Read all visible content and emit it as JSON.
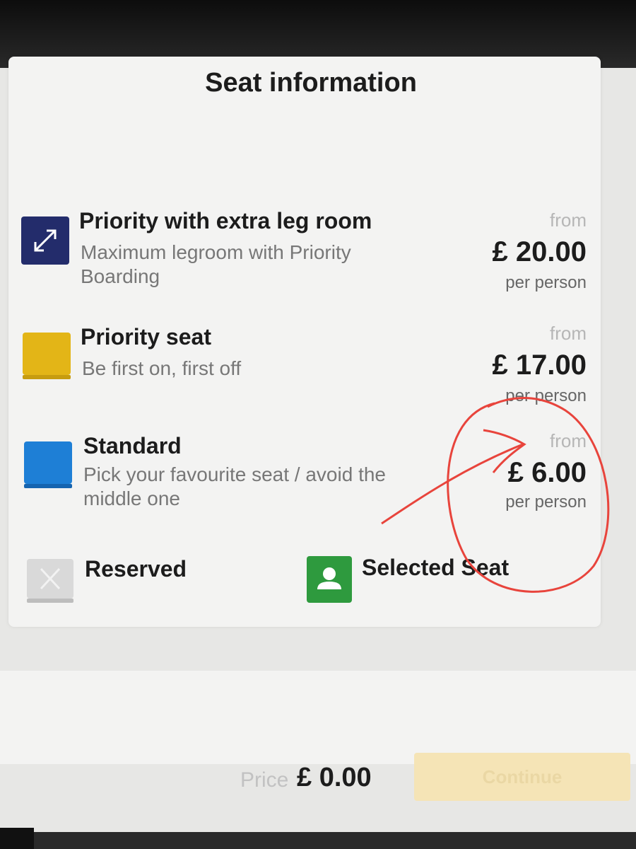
{
  "modal": {
    "title": "Seat information"
  },
  "seat_types": [
    {
      "name": "Priority with extra leg room",
      "description": "Maximum legroom with Priority Boarding",
      "from_label": "from",
      "price": "£ 20.00",
      "per_label": "per person",
      "icon": "legroom-arrows-icon",
      "color": "#232c6b"
    },
    {
      "name": "Priority seat",
      "description": "Be first on, first off",
      "from_label": "from",
      "price": "£ 17.00",
      "per_label": "per person",
      "icon": "priority-seat-icon",
      "color": "#e3b517"
    },
    {
      "name": "Standard",
      "description": "Pick your favourite seat / avoid the middle one",
      "from_label": "from",
      "price": "£ 6.00",
      "per_label": "per person",
      "icon": "standard-seat-icon",
      "color": "#1e7fd6"
    }
  ],
  "legend": {
    "reserved": {
      "label": "Reserved",
      "icon": "reserved-seat-icon",
      "color": "#d9d9d9"
    },
    "selected": {
      "label": "Selected Seat",
      "icon": "selected-seat-user-icon",
      "color": "#2e9a3e"
    }
  },
  "footer": {
    "price_label": "Price",
    "price_value": "£ 0.00",
    "continue_label": "Continue",
    "continue_color": "#f5e4b6"
  },
  "annotation": {
    "color": "#e8443c",
    "shapes": [
      "circle",
      "arrow"
    ]
  }
}
